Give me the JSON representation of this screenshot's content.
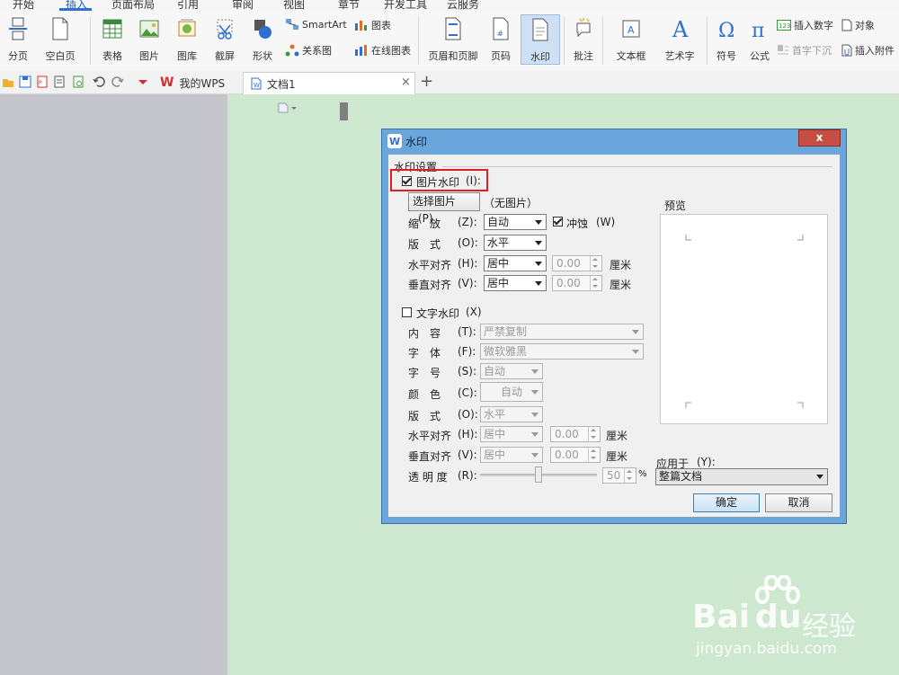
{
  "menu": {
    "tabs": [
      "开始",
      "插入",
      "页面布局",
      "引用",
      "审阅",
      "视图",
      "章节",
      "开发工具",
      "云服务"
    ],
    "active_tab": "插入"
  },
  "ribbon": {
    "page_break": "分页",
    "blank_page": "空白页",
    "table": "表格",
    "picture": "图片",
    "gallery": "图库",
    "screenshot": "截屏",
    "shape": "形状",
    "smartart": "SmartArt",
    "chart": "图表",
    "relation": "关系图",
    "online_chart": "在线图表",
    "header_footer": "页眉和页脚",
    "page_number": "页码",
    "watermark": "水印",
    "comment": "批注",
    "textbox": "文本框",
    "wordart": "艺术字",
    "symbol": "符号",
    "formula": "公式",
    "insert_number": "插入数字",
    "object": "对象",
    "drop_cap": "首字下沉",
    "attachment": "插入附件"
  },
  "doc_tabs": {
    "tab1": "我的WPS",
    "tab2": "文档1",
    "close": "×",
    "add": "+"
  },
  "dialog": {
    "title": "水印",
    "close": "x",
    "section_title": "水印设置",
    "picture_watermark": {
      "label": "图片水印",
      "shortcut": "(I):",
      "checked": true,
      "select_button": "选择图片",
      "select_shortcut": "(P)",
      "no_picture": "（无图片）",
      "scale_label": "缩　放",
      "scale_shortcut": "(Z):",
      "scale_value": "自动",
      "washout_label": "冲蚀",
      "washout_shortcut": "(W)",
      "washout_checked": true,
      "layout_label": "版　式",
      "layout_shortcut": "(O):",
      "layout_value": "水平",
      "halign_label": "水平对齐",
      "halign_shortcut": "(H):",
      "halign_value": "居中",
      "halign_offset": "0.00",
      "valign_label": "垂直对齐",
      "valign_shortcut": "(V):",
      "valign_value": "居中",
      "valign_offset": "0.00",
      "unit": "厘米"
    },
    "text_watermark": {
      "label": "文字水印",
      "shortcut": "(X)",
      "checked": false,
      "content_label": "内　容",
      "content_shortcut": "(T):",
      "content_value": "严禁复制",
      "font_label": "字　体",
      "font_shortcut": "(F):",
      "font_value": "微软雅黑",
      "size_label": "字　号",
      "size_shortcut": "(S):",
      "size_value": "自动",
      "color_label": "颜　色",
      "color_shortcut": "(C):",
      "color_value": "自动",
      "layout_label": "版　式",
      "layout_shortcut": "(O):",
      "layout_value": "水平",
      "halign_label": "水平对齐",
      "halign_shortcut": "(H):",
      "halign_value": "居中",
      "halign_offset": "0.00",
      "valign_label": "垂直对齐",
      "valign_shortcut": "(V):",
      "valign_value": "居中",
      "valign_offset": "0.00",
      "unit": "厘米",
      "transparency_label": "透 明 度",
      "transparency_shortcut": "(R):",
      "transparency_value": "50",
      "percent": "%"
    },
    "preview_label": "预览",
    "apply_to_label": "应用于",
    "apply_to_shortcut": "(Y):",
    "apply_to_value": "整篇文档",
    "ok": "确定",
    "cancel": "取消"
  },
  "watermark_logo": {
    "brand": "Bai",
    "brand2": "du",
    "cn": "经验",
    "url": "jingyan.baidu.com"
  },
  "colors": {
    "accent": "#2f6fd1",
    "highlight_box": "#e02020",
    "dialog_frame": "#6aa6dc",
    "page_bg": "#cde8cf"
  }
}
